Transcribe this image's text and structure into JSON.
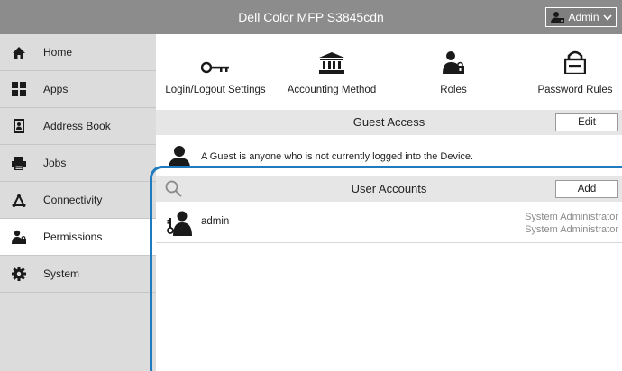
{
  "header": {
    "title": "Dell Color MFP S3845cdn",
    "user_label": "Admin",
    "user_icon": "admin-user-icon",
    "chevron_icon": "chevron-down-icon"
  },
  "sidebar": {
    "items": [
      {
        "label": "Home",
        "icon": "home-icon",
        "active": false
      },
      {
        "label": "Apps",
        "icon": "apps-grid-icon",
        "active": false
      },
      {
        "label": "Address Book",
        "icon": "address-book-icon",
        "active": false
      },
      {
        "label": "Jobs",
        "icon": "printer-jobs-icon",
        "active": false
      },
      {
        "label": "Connectivity",
        "icon": "network-icon",
        "active": false
      },
      {
        "label": "Permissions",
        "icon": "permissions-icon",
        "active": true
      },
      {
        "label": "System",
        "icon": "gear-icon",
        "active": false
      }
    ]
  },
  "toolbar": {
    "items": [
      {
        "label": "Login/Logout Settings",
        "icon": "key-icon"
      },
      {
        "label": "Accounting Method",
        "icon": "bank-icon"
      },
      {
        "label": "Roles",
        "icon": "user-lock-icon"
      },
      {
        "label": "Password Rules",
        "icon": "padlock-icon"
      }
    ]
  },
  "guest": {
    "title": "Guest Access",
    "edit_label": "Edit",
    "description": "A Guest is anyone who is not currently logged into the Device.",
    "icon": "guest-person-icon"
  },
  "accounts": {
    "title": "User Accounts",
    "add_label": "Add",
    "search_icon": "search-icon",
    "rows": [
      {
        "name": "admin",
        "roles": [
          "System Administrator",
          "System Administrator"
        ],
        "icon": "admin-key-user-icon"
      }
    ]
  },
  "colors": {
    "topbar": "#8c8c8c",
    "sidebar": "#dcdcdc",
    "focus_frame": "#1f7bbd"
  }
}
